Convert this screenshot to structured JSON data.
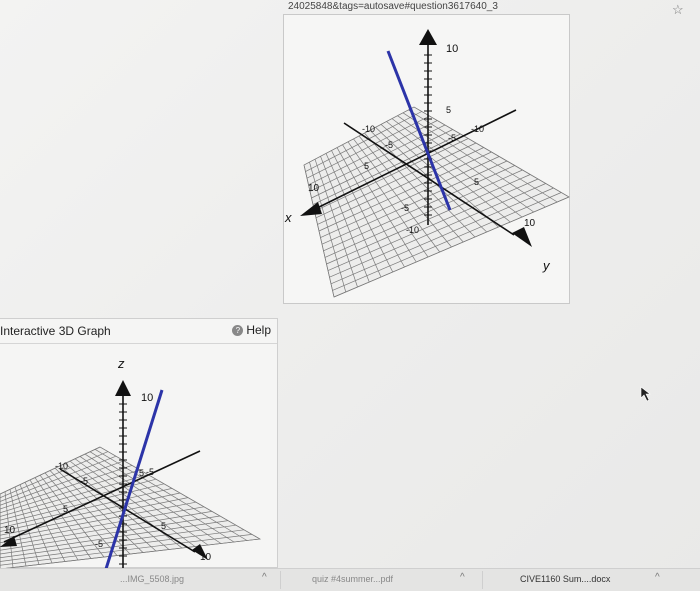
{
  "browser": {
    "url_fragment": "24025848&tags=autosave#question3617640_3",
    "bookmark_star": "☆"
  },
  "top_graph": {
    "z_tick_labels": [
      "10",
      "5",
      "-5",
      "-10"
    ],
    "x_tick_labels": [
      "10",
      "5",
      "-5",
      "-10"
    ],
    "y_tick_labels": [
      "-10",
      "-5",
      "5",
      "10"
    ],
    "x_axis_label": "x",
    "y_axis_label": "y",
    "line_color": "#2c34a8"
  },
  "bottom_panel": {
    "title": "Interactive 3D Graph",
    "help_label": "Help",
    "help_icon": "?",
    "z_axis_label": "z",
    "z_tick_labels": [
      "10",
      "5",
      "-5"
    ],
    "x_tick_labels": [
      "10",
      "5",
      "-5"
    ],
    "y_tick_labels": [
      "-10",
      "-5",
      "5",
      "10"
    ],
    "line_color": "#2c34a8"
  },
  "taskbar": {
    "downloads": [
      {
        "name": "...IMG_5508.jpg",
        "chevron": "^"
      },
      {
        "name": "quiz #4summer...pdf",
        "chevron": "^"
      },
      {
        "name": "CIVE1160 Sum....docx",
        "chevron": "^"
      }
    ]
  }
}
